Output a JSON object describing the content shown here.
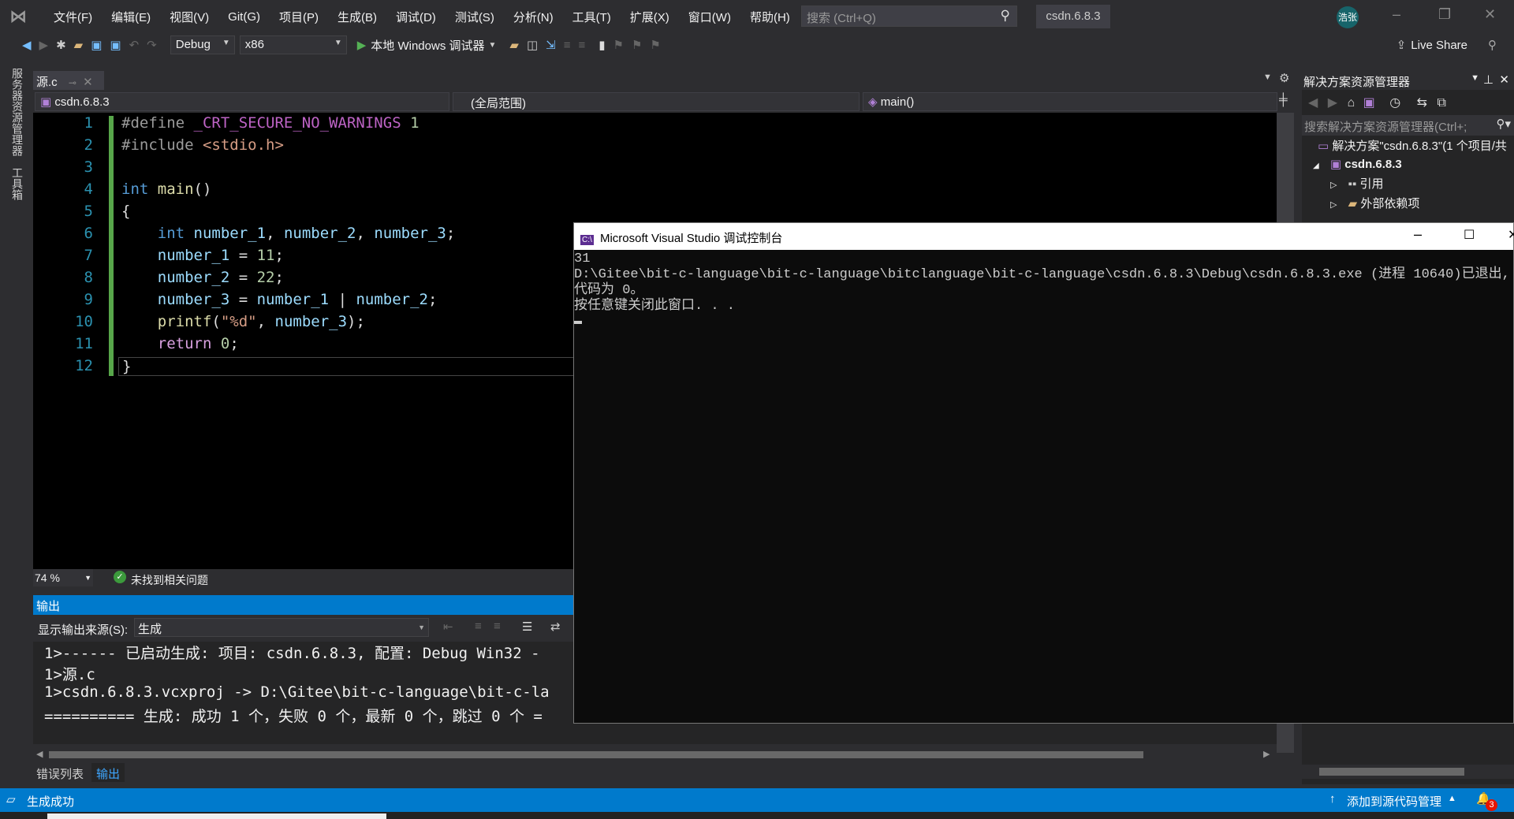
{
  "menubar": {
    "items": [
      "文件(F)",
      "编辑(E)",
      "视图(V)",
      "Git(G)",
      "项目(P)",
      "生成(B)",
      "调试(D)",
      "测试(S)",
      "分析(N)",
      "工具(T)",
      "扩展(X)",
      "窗口(W)",
      "帮助(H)"
    ],
    "search_placeholder": "搜索 (Ctrl+Q)",
    "solution_name": "csdn.6.8.3",
    "avatar": "浩张"
  },
  "toolbar": {
    "config": "Debug",
    "platform": "x86",
    "debugger": "本地 Windows 调试器",
    "live_share": "Live Share"
  },
  "left_strip": [
    "服务器资源管理器",
    "工具箱"
  ],
  "doc_tab": {
    "label": "源.c"
  },
  "navbar": {
    "project": "csdn.6.8.3",
    "scope": "(全局范围)",
    "member": "main()"
  },
  "editor": {
    "line_numbers": [
      "1",
      "2",
      "3",
      "4",
      "5",
      "6",
      "7",
      "8",
      "9",
      "10",
      "11",
      "12"
    ],
    "zoom": "74 %",
    "issues": "未找到相关问题"
  },
  "output": {
    "title": "输出",
    "source_label": "显示输出来源(S):",
    "source_value": "生成",
    "lines": [
      "1>------ 已启动生成: 项目: csdn.6.8.3, 配置: Debug Win32 -",
      "1>源.c",
      "1>csdn.6.8.3.vcxproj -> D:\\Gitee\\bit-c-language\\bit-c-la",
      "========== 生成: 成功 1 个，失败 0 个，最新 0 个，跳过 0 个 ="
    ]
  },
  "bottom_tabs": [
    "错误列表",
    "输出"
  ],
  "statusbar": {
    "message": "生成成功",
    "source_control": "添加到源代码管理",
    "notifications": "3"
  },
  "solution_explorer": {
    "title": "解决方案资源管理器",
    "search_placeholder": "搜索解决方案资源管理器(Ctrl+;",
    "items": [
      "解决方案\"csdn.6.8.3\"(1 个项目/共",
      "csdn.6.8.3",
      "引用",
      "外部依赖项"
    ]
  },
  "console": {
    "title": "Microsoft Visual Studio 调试控制台",
    "lines": [
      "31",
      "D:\\Gitee\\bit-c-language\\bit-c-language\\bitclanguage\\bit-c-language\\csdn.6.8.3\\Debug\\csdn.6.8.3.exe (进程 10640)已退出,",
      "代码为 0。",
      "按任意键关闭此窗口. . ."
    ]
  },
  "colors": {
    "accent": "#007acc",
    "editor_bg": "#000000",
    "ide_bg": "#2d2d30"
  }
}
